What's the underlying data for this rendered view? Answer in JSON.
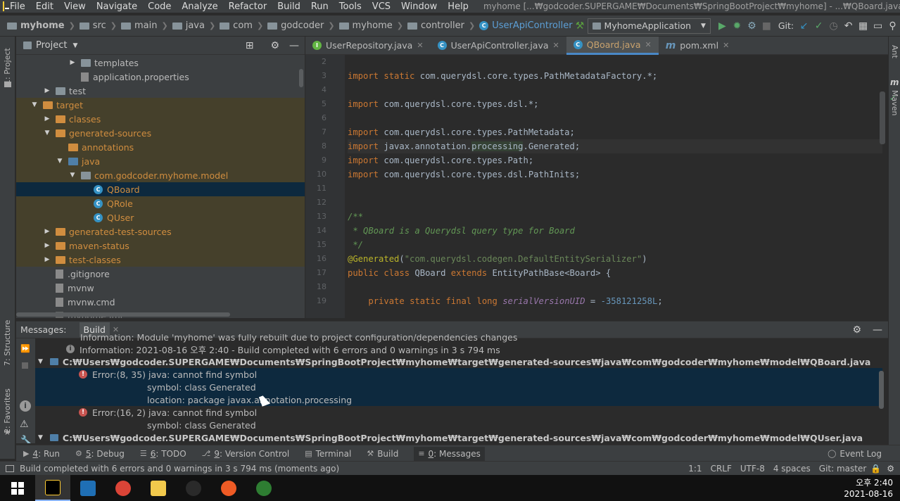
{
  "menubar": {
    "items": [
      "File",
      "Edit",
      "View",
      "Navigate",
      "Code",
      "Analyze",
      "Refactor",
      "Build",
      "Run",
      "Tools",
      "VCS",
      "Window",
      "Help"
    ],
    "title": "myhome [...₩godcoder.SUPERGAME₩Documents₩SpringBootProject₩myhome] - ...₩QBoard.java"
  },
  "navbar": {
    "crumbs": [
      "myhome",
      "src",
      "main",
      "java",
      "com",
      "godcoder",
      "myhome",
      "controller",
      "UserApiController"
    ],
    "run_config": "MyhomeApplication",
    "git_label": "Git:"
  },
  "left_strip": {
    "project_label": "1: Project",
    "structure_label": "7: Structure",
    "favorites_label": "2: Favorites"
  },
  "right_strip": {
    "ant_label": "Ant",
    "maven_label": "Maven"
  },
  "project": {
    "header": "Project",
    "tree": [
      {
        "label": "templates",
        "indent": 4,
        "arrow": "▶",
        "icon": "folder-gray",
        "style": "normal"
      },
      {
        "label": "application.properties",
        "indent": 4,
        "arrow": "",
        "icon": "properties-file",
        "style": "normal"
      },
      {
        "label": "test",
        "indent": 2,
        "arrow": "▶",
        "icon": "folder-gray",
        "style": "normal"
      },
      {
        "label": "target",
        "indent": 1,
        "arrow": "▼",
        "icon": "folder-orange",
        "style": "excluded"
      },
      {
        "label": "classes",
        "indent": 2,
        "arrow": "▶",
        "icon": "folder-orange",
        "style": "excluded"
      },
      {
        "label": "generated-sources",
        "indent": 2,
        "arrow": "▼",
        "icon": "folder-orange",
        "style": "excluded"
      },
      {
        "label": "annotations",
        "indent": 3,
        "arrow": "",
        "icon": "folder-orange",
        "style": "excluded"
      },
      {
        "label": "java",
        "indent": 3,
        "arrow": "▼",
        "icon": "folder-blue",
        "style": "excluded"
      },
      {
        "label": "com.godcoder.myhome.model",
        "indent": 4,
        "arrow": "▼",
        "icon": "package",
        "style": "excluded"
      },
      {
        "label": "QBoard",
        "indent": 5,
        "arrow": "",
        "icon": "class",
        "style": "selected"
      },
      {
        "label": "QRole",
        "indent": 5,
        "arrow": "",
        "icon": "class",
        "style": "excluded"
      },
      {
        "label": "QUser",
        "indent": 5,
        "arrow": "",
        "icon": "class",
        "style": "excluded"
      },
      {
        "label": "generated-test-sources",
        "indent": 2,
        "arrow": "▶",
        "icon": "folder-orange",
        "style": "excluded"
      },
      {
        "label": "maven-status",
        "indent": 2,
        "arrow": "▶",
        "icon": "folder-orange",
        "style": "excluded"
      },
      {
        "label": "test-classes",
        "indent": 2,
        "arrow": "▶",
        "icon": "folder-orange",
        "style": "excluded"
      },
      {
        "label": ".gitignore",
        "indent": 2,
        "arrow": "",
        "icon": "file",
        "style": "normal"
      },
      {
        "label": "mvnw",
        "indent": 2,
        "arrow": "",
        "icon": "file",
        "style": "normal"
      },
      {
        "label": "mvnw.cmd",
        "indent": 2,
        "arrow": "",
        "icon": "file",
        "style": "normal"
      },
      {
        "label": "myhome.iml",
        "indent": 2,
        "arrow": "",
        "icon": "file",
        "style": "normal"
      }
    ]
  },
  "editor": {
    "tabs": [
      {
        "label": "UserRepository.java",
        "icon": "interface",
        "active": false
      },
      {
        "label": "UserApiController.java",
        "icon": "class",
        "active": false
      },
      {
        "label": "QBoard.java",
        "icon": "class",
        "active": true
      },
      {
        "label": "pom.xml",
        "icon": "maven",
        "active": false
      }
    ],
    "line_numbers": [
      "2",
      "3",
      "4",
      "5",
      "6",
      "7",
      "8",
      "9",
      "10",
      "11",
      "12",
      "13",
      "14",
      "15",
      "16",
      "17",
      "18",
      "19"
    ],
    "current_line": 8,
    "lines": [
      "",
      "import static com.querydsl.core.types.PathMetadataFactory.*;",
      "",
      "import com.querydsl.core.types.dsl.*;",
      "",
      "import com.querydsl.core.types.PathMetadata;",
      "import javax.annotation.processing.Generated;",
      "import com.querydsl.core.types.Path;",
      "import com.querydsl.core.types.dsl.PathInits;",
      "",
      "",
      "/**",
      " * QBoard is a Querydsl query type for Board",
      " */",
      "@Generated(\"com.querydsl.codegen.DefaultEntitySerializer\")",
      "public class QBoard extends EntityPathBase<Board> {",
      "",
      "    private static final long serialVersionUID = -358121258L;"
    ]
  },
  "messages": {
    "title": "Messages:",
    "tab": "Build",
    "rows": [
      {
        "type": "clipped",
        "text": "Information: Module 'myhome' was fully rebuilt due to project configuration/dependencies changes"
      },
      {
        "type": "info",
        "text": "Information: 2021-08-16 오후 2:40 - Build completed with 6 errors and 0 warnings in 3 s 794 ms"
      },
      {
        "type": "path",
        "text": "C:₩Users₩godcoder.SUPERGAME₩Documents₩SpringBootProject₩myhome₩target₩generated-sources₩java₩com₩godcoder₩myhome₩model₩QBoard.java"
      },
      {
        "type": "error",
        "text": "Error:(8, 35)  java: cannot find symbol",
        "selected": true
      },
      {
        "type": "detail",
        "text": "symbol:   class Generated",
        "selected": true
      },
      {
        "type": "detail",
        "text": "location: package javax.annotation.processing",
        "selected": true
      },
      {
        "type": "error",
        "text": "Error:(16, 2)  java: cannot find symbol",
        "selected": false
      },
      {
        "type": "detail",
        "text": "symbol: class Generated",
        "selected": false
      },
      {
        "type": "path",
        "text": "C:₩Users₩godcoder.SUPERGAME₩Documents₩SpringBootProject₩myhome₩target₩generated-sources₩java₩com₩godcoder₩myhome₩model₩QUser.java"
      }
    ]
  },
  "tooltabs": {
    "items": [
      {
        "num": "4",
        "label": ": Run",
        "icon": "▶"
      },
      {
        "num": "5",
        "label": ": Debug",
        "icon": "⚙"
      },
      {
        "num": "6",
        "label": ": TODO",
        "icon": "☰"
      },
      {
        "num": "9",
        "label": ": Version Control",
        "icon": "⎇"
      },
      {
        "num": "",
        "label": "Terminal",
        "icon": "▤"
      },
      {
        "num": "",
        "label": "Build",
        "icon": "⚒"
      },
      {
        "num": "0",
        "label": ": Messages",
        "icon": "≡",
        "active": true
      }
    ],
    "event_log": "Event Log"
  },
  "statusbar": {
    "message": "Build completed with 6 errors and 0 warnings in 3 s 794 ms (moments ago)",
    "position": "1:1",
    "line_sep": "CRLF",
    "encoding": "UTF-8",
    "indent": "4 spaces",
    "git": "Git: master"
  },
  "taskbar": {
    "time": "오후 2:40",
    "date": "2021-08-16",
    "apps": [
      {
        "name": "intellij",
        "color": "#000000",
        "active": true
      },
      {
        "name": "vscode",
        "color": "#1f6fb5",
        "active": false
      },
      {
        "name": "chrome",
        "color": "#db4437",
        "active": false
      },
      {
        "name": "explorer",
        "color": "#f2c94c",
        "active": false
      },
      {
        "name": "obs",
        "color": "#2a2a2a",
        "active": false
      },
      {
        "name": "postman",
        "color": "#ef5b25",
        "active": false
      },
      {
        "name": "hs-app",
        "color": "#2e7d32",
        "active": false
      }
    ]
  },
  "colors": {
    "selection": "#0d293e",
    "excluded_bg": "#45402b",
    "excluded_fg": "#d08d3f",
    "error": "#c75450",
    "keyword": "#cc7832",
    "string": "#6a8759",
    "annotation": "#bbb529"
  }
}
